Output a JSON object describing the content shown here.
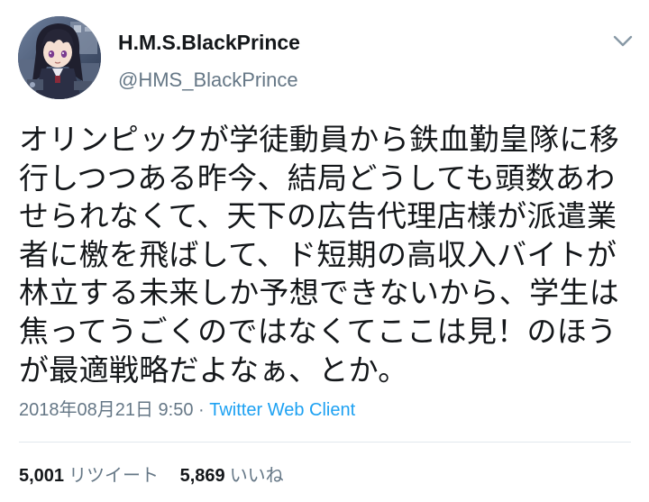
{
  "user": {
    "display_name": "H.M.S.BlackPrince",
    "handle": "@HMS_BlackPrince"
  },
  "tweet": {
    "lines": [
      "オリンピックが学徒動員から鉄血勤皇隊に移",
      "行しつつある昨今、結局どうしても頭数あわ",
      "せられなくて、天下の広告代理店様が派遣業",
      "者に檄を飛ばして、ド短期の高収入バイトが",
      "林立する未来しか予想できないから、学生は",
      "焦ってうごくのではなくてここは見！のほう",
      "が最適戦略だよなぁ、とか。"
    ],
    "timestamp": "2018年08月21日 9:50",
    "separator": " · ",
    "client": "Twitter Web Client"
  },
  "stats": {
    "retweets_count": "5,001",
    "retweets_label": "リツイート",
    "likes_count": "5,869",
    "likes_label": "いいね"
  },
  "colors": {
    "text": "#14171a",
    "secondary": "#657786",
    "link": "#1da1f2",
    "divider": "#e1e8ed"
  },
  "icons": {
    "avatar": "anime-character-avatar",
    "caret": "chevron-down-icon"
  }
}
